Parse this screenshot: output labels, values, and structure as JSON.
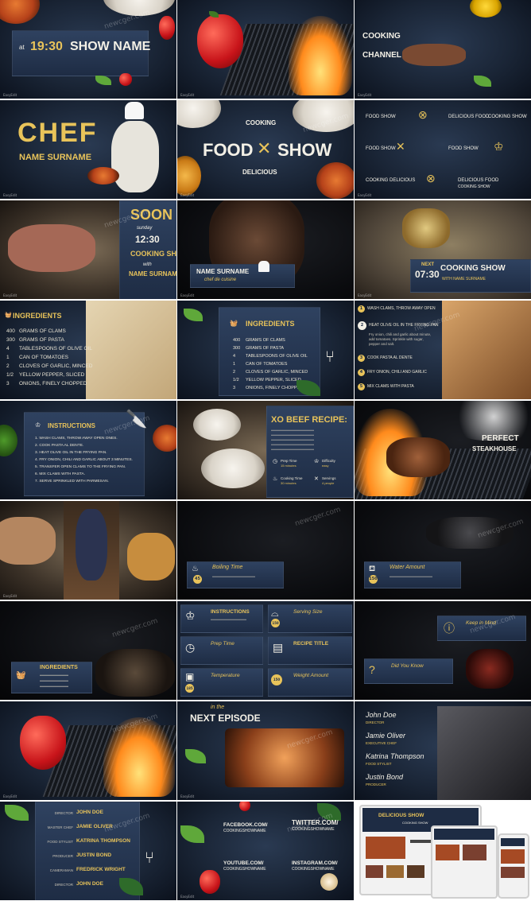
{
  "watermark": "newcger.com",
  "brand": "EasyEdit",
  "tiles": {
    "t1": {
      "at": "at",
      "time": "19:30",
      "show": "SHOW NAME"
    },
    "t3": {
      "cooking": "COOKING",
      "channel": "CHANNEL"
    },
    "t4": {
      "chef": "CHEF",
      "name": "NAME SURNAME"
    },
    "t5": {
      "cooking": "COOKING",
      "food": "FOOD",
      "show": "SHOW",
      "delicious": "DELICIOUS"
    },
    "t6": {
      "a": "FOOD SHOW",
      "b": "DELICIOUS FOOD",
      "c": "COOKING SHOW",
      "d": "FOOD SHOW",
      "e": "COOKING DELICIOUS",
      "f": "FOOD SHOW",
      "g": "DELICIOUS FOOD",
      "h": "COOKING SHOW"
    },
    "t7": {
      "soon": "SOON",
      "sunday": "sunday",
      "time": "12:30",
      "show": "COOKING SHOW",
      "with": "with",
      "name": "NAME SURNAME"
    },
    "t8": {
      "name": "NAME SURNAME",
      "role": "chef de cuisine"
    },
    "t9": {
      "next": "NEXT",
      "time": "07:30",
      "show": "COOKING SHOW",
      "with": "WITH NAME SURNAME"
    },
    "ingredients": {
      "title": "INGREDIENTS",
      "items": [
        {
          "qty": "400",
          "text": "GRAMS OF CLAMS"
        },
        {
          "qty": "300",
          "text": "GRAMS OF PASTA"
        },
        {
          "qty": "4",
          "text": "TABLESPOONS OF OLIVE OIL"
        },
        {
          "qty": "1",
          "text": "CAN OF TOMATOES"
        },
        {
          "qty": "2",
          "text": "CLOVES OF GARLIC, MINCED"
        },
        {
          "qty": "1/2",
          "text": "YELLOW PEPPER, SLICED"
        },
        {
          "qty": "3",
          "text": "ONIONS, FINELY CHOPPED"
        }
      ]
    },
    "t12": {
      "steps": [
        {
          "n": "1",
          "text": "WASH CLAMS, THROW AWAY OPEN"
        },
        {
          "n": "2",
          "text": "HEAT OLIVE OIL IN THE FRYING PAN"
        },
        {
          "n": "",
          "text": "Fry onion, chili and garlic about minute, add tomatoes. Sprinkle with sugar, pepper and salt."
        },
        {
          "n": "3",
          "text": "COOK PASTA AL DENTE"
        },
        {
          "n": "4",
          "text": "FRY ONION, CHILI AND GARLIC"
        },
        {
          "n": "5",
          "text": "MIX CLAMS WITH PASTA"
        }
      ]
    },
    "t13": {
      "title": "INSTRUCTIONS",
      "steps": [
        "WASH CLAMS, THROW AWAY OPEN ONES.",
        "COOK PASTA AL DENTE.",
        "HEAT OLIVE OIL IN THE FRYING PAN.",
        "FRY ONION, CHILI AND GARLIC ABOUT 3 MINUTES.",
        "TRANSFER OPEN CLAMS TO THE FRYING PAN.",
        "MIX CLAMS WITH PASTA.",
        "SERVE SPRINKLED WITH PARMESAN."
      ]
    },
    "t14": {
      "title": "XO BEEF RECIPE:",
      "prep": "Prep Time",
      "prep_v": "15 minutes",
      "diff": "Difficulty",
      "diff_v": "easy",
      "cook": "Cooking Time",
      "cook_v": "30 minutes",
      "serv": "Servings",
      "serv_v": "4 people"
    },
    "t15": {
      "perfect": "PERFECT",
      "steakhouse": "STEAKHOUSE"
    },
    "t17": {
      "title": "Boiling Time",
      "badge": "45"
    },
    "t18": {
      "title": "Water Amount",
      "badge": "150"
    },
    "t19": {
      "title": "INGREDIENTS"
    },
    "t20": {
      "instructions": "INSTRUCTIONS",
      "serving": "Serving Size",
      "serving_badge": "150",
      "prep": "Prep Time",
      "recipe": "RECIPE TITLE",
      "temp": "Temperature",
      "temp_badge": "185",
      "weight": "Weight Amount",
      "weight_badge": "150"
    },
    "t21": {
      "keep": "Keep in Mind",
      "did": "Did You Know"
    },
    "t23": {
      "inthe": "in the",
      "next": "NEXT EPISODE"
    },
    "t24": {
      "credits": [
        {
          "name": "John Doe",
          "role": "DIRECTOR"
        },
        {
          "name": "Jamie Oliver",
          "role": "EXECUTIVE CHEF"
        },
        {
          "name": "Katrina Thompson",
          "role": "FOOD STYLIST"
        },
        {
          "name": "Justin Bond",
          "role": "PRODUCER"
        }
      ]
    },
    "t25": {
      "rows": [
        {
          "role": "DIRECTOR",
          "name": "JOHN DOE"
        },
        {
          "role": "MASTER CHEF",
          "name": "JAMIE OLIVER"
        },
        {
          "role": "FOOD STYLIST",
          "name": "KATRINA THOMPSON"
        },
        {
          "role": "PRODUCER",
          "name": "JUSTIN BOND"
        },
        {
          "role": "CAMERAMAN",
          "name": "FREDRICK WRIGHT"
        },
        {
          "role": "DIRECTOR",
          "name": "JOHN DOE"
        }
      ]
    },
    "t26": {
      "fb": "FACEBOOK.COM/",
      "fb2": "COOKINGSHOWNAME",
      "tw": "TWITTER.COM/",
      "tw2": "COOKINGSHOWNAME",
      "yt": "YOUTUBE.COM/",
      "yt2": "COOKINGSHOWNAME",
      "ig": "INSTAGRAM.COM/",
      "ig2": "COOKINGSHOWNAME"
    },
    "t27": {
      "brand": "DELICIOUS SHOW",
      "sub": "COOKING SHOW"
    },
    "t11": {
      "title": "INGREDIENTS"
    }
  },
  "colors": {
    "accent": "#e8c35a",
    "panel": "#2b3c58",
    "board": "#1a2536"
  }
}
